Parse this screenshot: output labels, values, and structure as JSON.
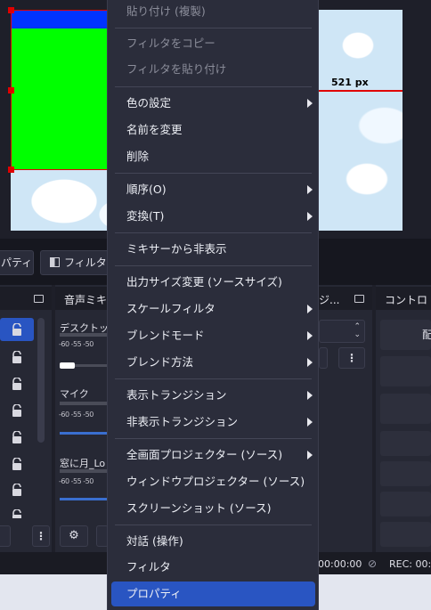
{
  "preview": {
    "width_label": "521 px"
  },
  "toolbar": {
    "properties_label": "パティ",
    "filter_label": "フィルタ"
  },
  "mixer": {
    "title": "音声ミキ",
    "channels": [
      {
        "name": "デスクトップ",
        "scale": "-60 -55 -50"
      },
      {
        "name": "マイク",
        "scale": "-60 -55 -50"
      },
      {
        "name": "窓に月_Lo",
        "scale": "-60 -55 -50"
      }
    ]
  },
  "transitions": {
    "title": "ジ..."
  },
  "controls": {
    "title": "コントロ",
    "first_button": "配"
  },
  "status": {
    "time1": "00:00:00",
    "rec_label": "REC: 00:"
  },
  "menu": {
    "items": [
      {
        "label": "貼り付け (複製)",
        "disabled": true,
        "submenu": false
      },
      {
        "label": "フィルタをコピー",
        "disabled": true,
        "submenu": false
      },
      {
        "label": "フィルタを貼り付け",
        "disabled": true,
        "submenu": false
      },
      {
        "label": "色の設定",
        "disabled": false,
        "submenu": true
      },
      {
        "label": "名前を変更",
        "disabled": false,
        "submenu": false
      },
      {
        "label": "削除",
        "disabled": false,
        "submenu": false
      },
      {
        "label": "順序(O)",
        "disabled": false,
        "submenu": true
      },
      {
        "label": "変換(T)",
        "disabled": false,
        "submenu": true
      },
      {
        "label": "ミキサーから非表示",
        "disabled": false,
        "submenu": false
      },
      {
        "label": "出力サイズ変更 (ソースサイズ)",
        "disabled": false,
        "submenu": false
      },
      {
        "label": "スケールフィルタ",
        "disabled": false,
        "submenu": true
      },
      {
        "label": "ブレンドモード",
        "disabled": false,
        "submenu": true
      },
      {
        "label": "ブレンド方法",
        "disabled": false,
        "submenu": true
      },
      {
        "label": "表示トランジション",
        "disabled": false,
        "submenu": true
      },
      {
        "label": "非表示トランジション",
        "disabled": false,
        "submenu": true
      },
      {
        "label": "全画面プロジェクター (ソース)",
        "disabled": false,
        "submenu": true
      },
      {
        "label": "ウィンドウプロジェクター (ソース)",
        "disabled": false,
        "submenu": false
      },
      {
        "label": "スクリーンショット (ソース)",
        "disabled": false,
        "submenu": false
      },
      {
        "label": "対話 (操作)",
        "disabled": false,
        "submenu": false
      },
      {
        "label": "フィルタ",
        "disabled": false,
        "submenu": false
      },
      {
        "label": "プロパティ",
        "disabled": false,
        "submenu": false,
        "active": true
      }
    ]
  },
  "colors": {
    "accent": "#2955c2",
    "selection": "#e00000"
  }
}
